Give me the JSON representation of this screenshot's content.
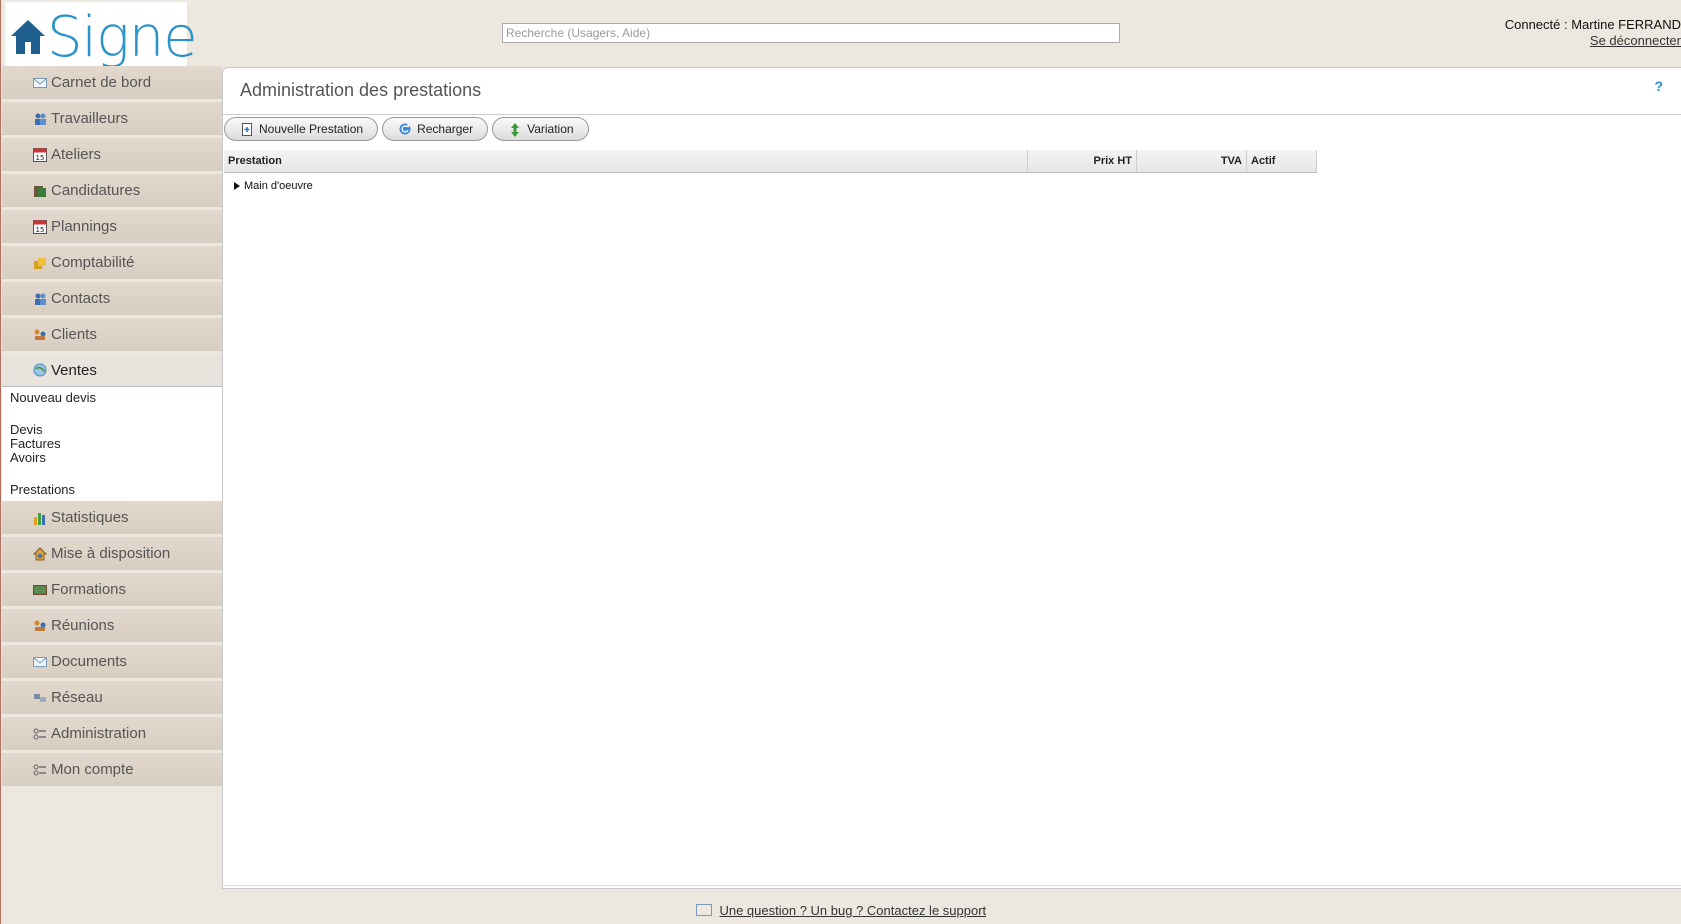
{
  "header": {
    "logo_text": "Signe",
    "search_placeholder": "Recherche (Usagers, Aide)",
    "connected_label": "Connecté : Martine FERRAND",
    "logout_label": "Se déconnecter"
  },
  "sidebar": {
    "items_top": [
      {
        "label": "Carnet de bord",
        "icon": "envelope-icon"
      },
      {
        "label": "Travailleurs",
        "icon": "people-icon"
      },
      {
        "label": "Ateliers",
        "icon": "calendar-icon"
      },
      {
        "label": "Candidatures",
        "icon": "folder-icon"
      },
      {
        "label": "Plannings",
        "icon": "calendar-icon"
      },
      {
        "label": "Comptabilité",
        "icon": "coins-icon"
      },
      {
        "label": "Contacts",
        "icon": "people-icon"
      },
      {
        "label": "Clients",
        "icon": "handshake-icon"
      }
    ],
    "active_item": {
      "label": "Ventes",
      "icon": "globe-icon"
    },
    "submenu": {
      "nouveau_devis": "Nouveau devis",
      "devis": "Devis",
      "factures": "Factures",
      "avoirs": "Avoirs",
      "prestations": "Prestations"
    },
    "items_bottom": [
      {
        "label": "Statistiques",
        "icon": "bar-chart-icon"
      },
      {
        "label": "Mise à disposition",
        "icon": "house-user-icon"
      },
      {
        "label": "Formations",
        "icon": "board-icon"
      },
      {
        "label": "Réunions",
        "icon": "handshake-icon"
      },
      {
        "label": "Documents",
        "icon": "envelope-icon"
      },
      {
        "label": "Réseau",
        "icon": "network-icon"
      },
      {
        "label": "Administration",
        "icon": "settings-list-icon"
      },
      {
        "label": "Mon compte",
        "icon": "settings-list-icon"
      }
    ]
  },
  "main": {
    "title": "Administration des prestations",
    "help_label": "?",
    "toolbar": {
      "new_label": "Nouvelle Prestation",
      "reload_label": "Recharger",
      "variation_label": "Variation"
    },
    "grid": {
      "columns": [
        "Prestation",
        "Prix HT",
        "TVA",
        "Actif"
      ],
      "rows": [
        {
          "label": "Main d'oeuvre"
        }
      ]
    }
  },
  "footer": {
    "support_label": "Une question ? Un bug ? Contactez le support"
  },
  "colors": {
    "brand": "#2a93c8",
    "sidebar_bg": "#ddd3c8",
    "page_bg": "#ece8df"
  }
}
